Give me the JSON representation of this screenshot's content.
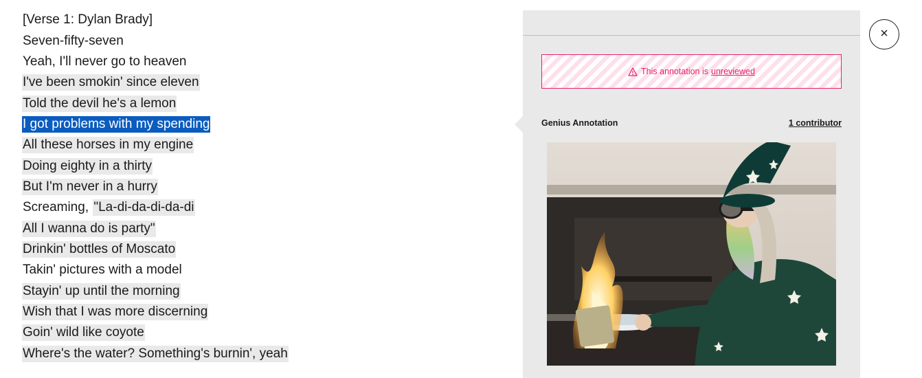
{
  "lyrics": [
    {
      "text": "[Verse 1: Dylan Brady]",
      "state": "plain"
    },
    {
      "text": "Seven-fifty-seven",
      "state": "plain"
    },
    {
      "text": "Yeah, I'll never go to heaven",
      "state": "plain"
    },
    {
      "text": "I've been smokin' since eleven",
      "state": "annotated"
    },
    {
      "text": "Told the devil he's a lemon",
      "state": "annotated"
    },
    {
      "text": "I got problems with my spending",
      "state": "active"
    },
    {
      "text": "All these horses in my engine",
      "state": "annotated"
    },
    {
      "text": "Doing eighty in a thirty",
      "state": "annotated"
    },
    {
      "text": "But I'm never in a hurry",
      "state": "annotated"
    },
    {
      "text": "Screaming, ",
      "text2": "\"La-di-da-di-da-di",
      "state": "split"
    },
    {
      "text": "All I wanna do is party\"",
      "state": "annotated"
    },
    {
      "text": "Drinkin' bottles of Moscato",
      "state": "annotated"
    },
    {
      "text": "Takin' pictures with a model",
      "state": "plain"
    },
    {
      "text": "Stayin' up until the morning",
      "state": "annotated"
    },
    {
      "text": "Wish that I was more discerning",
      "state": "annotated"
    },
    {
      "text": "Goin' wild like coyote",
      "state": "annotated"
    },
    {
      "text": "Where's the water? Something's burnin', yeah",
      "state": "annotated"
    }
  ],
  "annotation": {
    "warning_prefix": "This annotation is",
    "warning_link": "unreviewed",
    "source_label": "Genius Annotation",
    "contributors": "1 contributor",
    "image_icon": "wizard-burning-money-image"
  },
  "close_icon": "close-icon",
  "colors": {
    "highlight": "#e9e9e9",
    "active": "#0b5cbf",
    "warning": "#e91e6b",
    "panel": "#e9e9e9"
  }
}
